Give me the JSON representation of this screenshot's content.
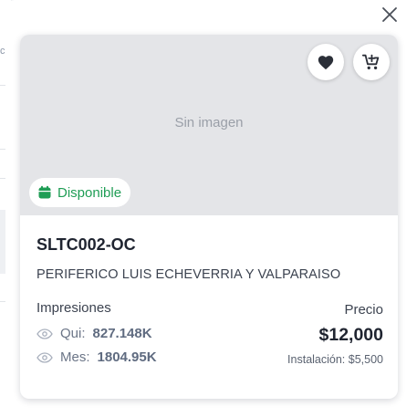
{
  "card": {
    "no_image_text": "Sin imagen",
    "status": "Disponible",
    "code": "SLTC002-OC",
    "address": "PERIFERICO LUIS ECHEVERRIA Y VALPARAISO",
    "impressions": {
      "title": "Impresiones",
      "qui_label": "Qui:",
      "qui_value": "827.148K",
      "mes_label": "Mes:",
      "mes_value": "1804.95K"
    },
    "price": {
      "label": "Precio",
      "value": "$12,000",
      "installation": "Instalación: $5,500"
    }
  },
  "icons": {
    "close": "close-icon",
    "favorite": "heart-icon",
    "cart": "cart-add-icon",
    "status": "calendar-icon",
    "views": "eye-icon"
  },
  "colors": {
    "status_green": "#1f9d55",
    "image_placeholder": "#e4e5e8",
    "text_dark": "#1f2430"
  }
}
